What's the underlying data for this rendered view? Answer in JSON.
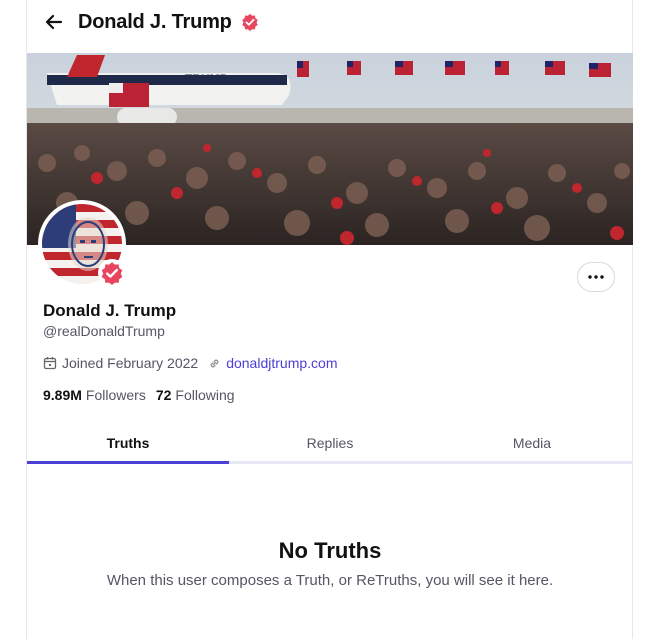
{
  "header": {
    "title": "Donald J. Trump",
    "back_icon": "arrow-left-icon",
    "verified_icon": "verified-badge-icon"
  },
  "profile": {
    "display_name": "Donald J. Trump",
    "handle": "@realDonaldTrump",
    "joined": "Joined February 2022",
    "website": "donaldjtrump.com",
    "followers_count": "9.89M",
    "followers_label": "Followers",
    "following_count": "72",
    "following_label": "Following",
    "banner_plane_text": "TRUMP"
  },
  "tabs": [
    {
      "label": "Truths",
      "active": true
    },
    {
      "label": "Replies",
      "active": false
    },
    {
      "label": "Media",
      "active": false
    }
  ],
  "empty_state": {
    "title": "No Truths",
    "subtitle": "When this user composes a Truth, or ReTruths, you will see it here."
  },
  "colors": {
    "accent": "#4b3fd6",
    "verified": "#e8455f"
  }
}
